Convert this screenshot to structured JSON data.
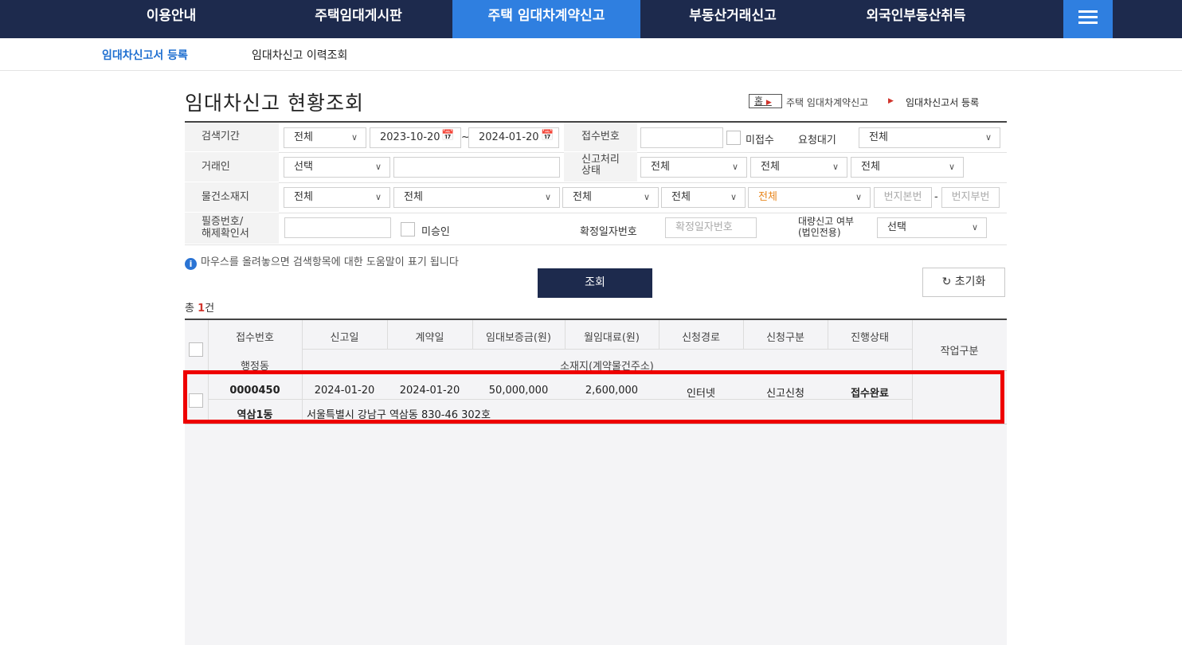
{
  "nav": {
    "items": [
      "이용안내",
      "주택임대게시판",
      "주택 임대차계약신고",
      "부동산거래신고",
      "외국인부동산취득"
    ],
    "active_index": 2
  },
  "subnav": {
    "items": [
      "임대차신고서 등록",
      "임대차신고 이력조회"
    ],
    "active_index": 0
  },
  "page_title": "임대차신고 현황조회",
  "breadcrumb": {
    "home": "홈",
    "items": [
      "주택 임대차계약신고",
      "임대차신고서 등록"
    ]
  },
  "search": {
    "period_label": "검색기간",
    "period_select": "전체",
    "date_from": "2023-10-20",
    "date_sep": "~",
    "date_to": "2024-01-20",
    "receipt_no_label": "접수번호",
    "not_received_label": "미접수",
    "request_wait_label": "요청대기",
    "request_wait_select": "전체",
    "trader_label": "거래인",
    "trader_select": "선택",
    "process_status_label": "신고처리\n상태",
    "process_selects": [
      "전체",
      "전체",
      "전체"
    ],
    "location_label": "물건소재지",
    "location_selects": [
      "전체",
      "전체",
      "전체",
      "전체",
      "전체"
    ],
    "lot_main_placeholder": "번지본번",
    "lot_dash": "-",
    "lot_sub_placeholder": "번지부번",
    "cert_label": "필증번호/\n해제확인서",
    "unapproved_label": "미승인",
    "confirm_date_label": "확정일자번호",
    "confirm_date_placeholder": "확정일자번호",
    "bulk_label": "대량신고 여부\n(법인전용)",
    "bulk_select": "선택"
  },
  "help_text": "마우스를 올려놓으면 검색항목에 대한 도움말이 표기 됩니다",
  "buttons": {
    "search": "조회",
    "reset": "초기화"
  },
  "total": {
    "prefix": "총 ",
    "count": "1",
    "suffix": "건"
  },
  "table": {
    "headers": [
      "접수번호",
      "신고일",
      "계약일",
      "임대보증금(원)",
      "월임대료(원)",
      "신청경로",
      "신청구분",
      "진행상태",
      "작업구분"
    ],
    "subheaders": [
      "행정동",
      "소재지(계약물건주소)"
    ],
    "rows": [
      {
        "receipt_no": "0000450",
        "report_date": "2024-01-20",
        "contract_date": "2024-01-20",
        "deposit": "50,000,000",
        "rent": "2,600,000",
        "route": "인터넷",
        "category": "신고신청",
        "status": "접수완료",
        "dong": "역삼1동",
        "address": "서울특별시 강남구 역삼동 830-46 302호"
      }
    ]
  },
  "colors": {
    "nav_bg": "#1d2a4d",
    "nav_active": "#2f7fe0",
    "highlight": "#ee0000",
    "accent_orange": "#e8861d"
  }
}
